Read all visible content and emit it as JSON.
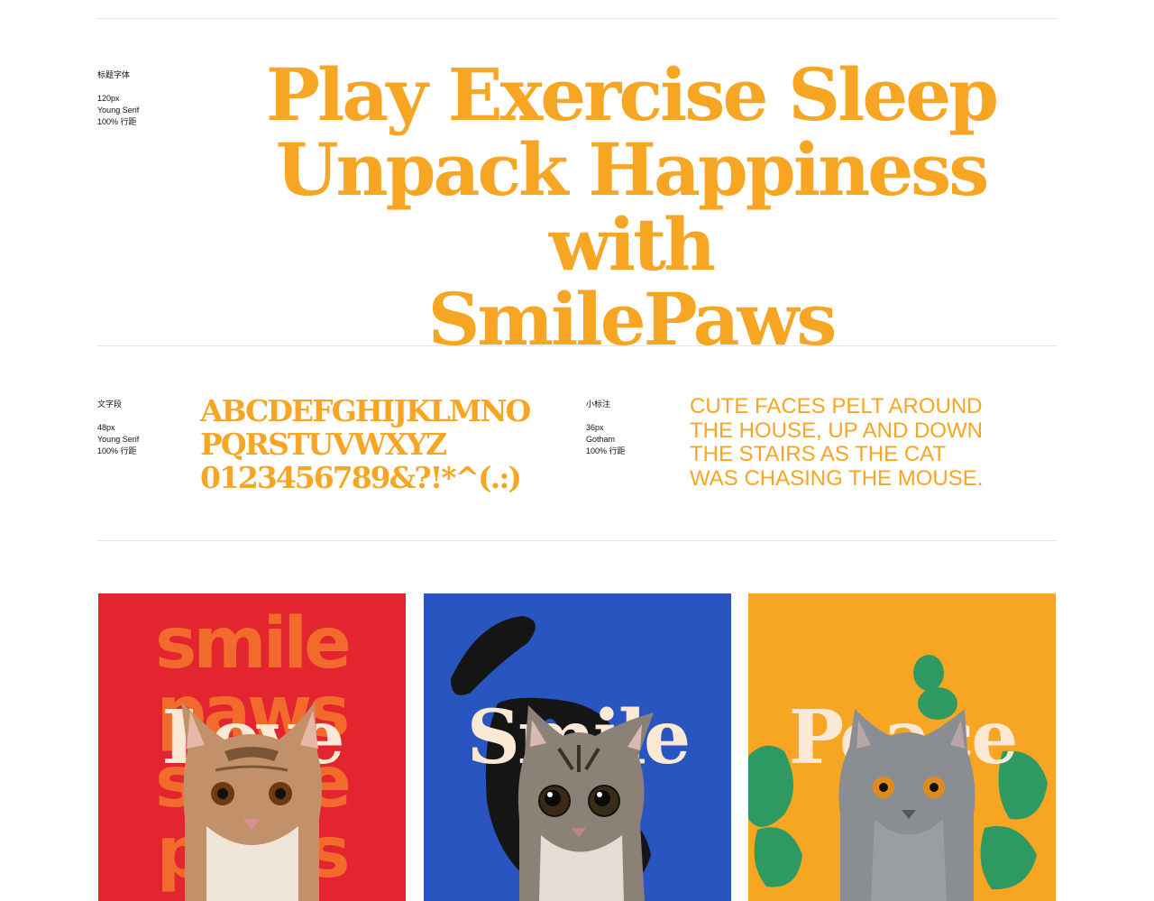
{
  "colors": {
    "accent": "#f6a623",
    "love_bg": "#e2252f",
    "love_letters": "#f26a2c",
    "smile_bg": "#2855c0",
    "smile_letters": "#151515",
    "peace_bg": "#f6a623",
    "peace_letters": "#2e9a62",
    "word_color": "#fbe9d6"
  },
  "headline_spec": {
    "title": "标题字体",
    "size": "120px",
    "font": "Young Serif",
    "leading": "100% 行距"
  },
  "headline": {
    "line1": "Play Exercise Sleep",
    "line2": "Unpack Happiness with",
    "line3": "SmilePaws"
  },
  "body_spec": {
    "title": "文字段",
    "size": "48px",
    "font": "Young Serif",
    "leading": "100% 行距"
  },
  "alphabet": {
    "line1": "ABCDEFGHIJKLMNO",
    "line2": "PQRSTUVWXYZ",
    "line3": "0123456789&?!*^(.:)"
  },
  "caption_spec": {
    "title": "小标注",
    "size": "36px",
    "font": "Gotham",
    "leading": "100% 行距"
  },
  "sample": {
    "line1": "CUTE FACES PELT AROUND",
    "line2": "THE HOUSE, UP AND DOWN",
    "line3": "THE STAIRS AS THE CAT",
    "line4": "WAS CHASING THE MOUSE."
  },
  "cards": [
    {
      "word": "Love",
      "bg_color": "#e2252f",
      "letters_color": "#f26a2c",
      "cat": "tabby-kitten",
      "letter_lines": [
        "smile",
        "paws",
        "smile",
        "paws"
      ]
    },
    {
      "word": "Smile",
      "bg_color": "#2855c0",
      "letters_color": "#151515",
      "cat": "gray-tabby-cat",
      "letter_lines": []
    },
    {
      "word": "Peace",
      "bg_color": "#f6a623",
      "letters_color": "#2e9a62",
      "cat": "british-shorthair-cat",
      "letter_lines": []
    }
  ],
  "icons": [
    "tabby-cat-photo",
    "gray-tabby-cat-photo",
    "british-shorthair-cat-photo"
  ]
}
